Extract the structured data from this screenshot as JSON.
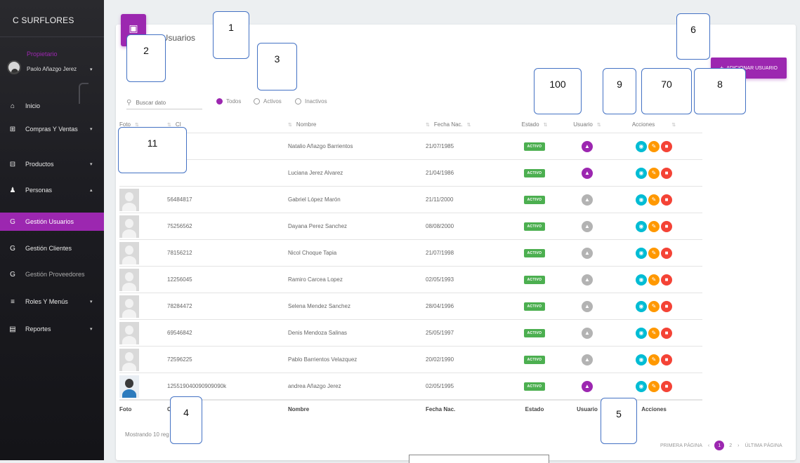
{
  "sidebar": {
    "brand": "C   SURFLORES",
    "role": "Propietario",
    "user_name": "Paolo Añazgo Jerez",
    "menu": [
      {
        "label": "Inicio",
        "icon": "home-icon",
        "glyph": "⌂",
        "caret": "",
        "active": false
      },
      {
        "label": "Compras Y Ventas",
        "icon": "cart-icon",
        "glyph": "⊞",
        "caret": "▾",
        "active": false
      },
      {
        "label": "Productos",
        "icon": "product-icon",
        "glyph": "⊟",
        "caret": "▾",
        "active": false
      },
      {
        "label": "Personas",
        "icon": "person-icon",
        "glyph": "♟",
        "caret": "▴",
        "active": false
      },
      {
        "label": "Gestión Usuarios",
        "icon": "letter-g-icon",
        "glyph": "G",
        "caret": "",
        "active": true
      },
      {
        "label": "Gestión Clientes",
        "icon": "letter-g-icon",
        "glyph": "G",
        "caret": "",
        "active": false
      },
      {
        "label": "Gestión Proveedores",
        "icon": "letter-g-icon",
        "glyph": "G",
        "caret": "",
        "active": false
      },
      {
        "label": "Roles Y Menús",
        "icon": "list-icon",
        "glyph": "≡",
        "caret": "▾",
        "active": false
      },
      {
        "label": "Reportes",
        "icon": "report-icon",
        "glyph": "▤",
        "caret": "▾",
        "active": false
      }
    ]
  },
  "card": {
    "title": "ón Usuarios",
    "add_button": "ADICIONAR USUARIO"
  },
  "filters": {
    "search_placeholder": "Buscar dato",
    "options": [
      "Todos",
      "Activos",
      "Inactivos"
    ],
    "selected": "Todos"
  },
  "table": {
    "headers": {
      "foto": "Foto",
      "ci": "CI",
      "nombre": "Nombre",
      "fecha": "Fecha Nac.",
      "estado": "Estado",
      "usuario": "Usuario",
      "acciones": "Acciones"
    },
    "rows": [
      {
        "ci": "",
        "nombre": "Natalio Añazgo Barrientos",
        "fecha": "21/07/1985",
        "estado": "ACTIVO",
        "usuario_on": true,
        "photo": "none"
      },
      {
        "ci": "",
        "nombre": "Luciana Jerez Alvarez",
        "fecha": "21/04/1986",
        "estado": "ACTIVO",
        "usuario_on": true,
        "photo": "none"
      },
      {
        "ci": "56484817",
        "nombre": "Gabriel López Marón",
        "fecha": "21/11/2000",
        "estado": "ACTIVO",
        "usuario_on": false,
        "photo": "default"
      },
      {
        "ci": "75256562",
        "nombre": "Dayana Perez Sanchez",
        "fecha": "08/08/2000",
        "estado": "ACTIVO",
        "usuario_on": false,
        "photo": "default"
      },
      {
        "ci": "78156212",
        "nombre": "Nicol Choque Tapia",
        "fecha": "21/07/1998",
        "estado": "ACTIVO",
        "usuario_on": false,
        "photo": "default"
      },
      {
        "ci": "12256045",
        "nombre": "Ramiro Carcea Lopez",
        "fecha": "02/05/1993",
        "estado": "ACTIVO",
        "usuario_on": false,
        "photo": "default"
      },
      {
        "ci": "78284472",
        "nombre": "Selena Mendez Sanchez",
        "fecha": "28/04/1996",
        "estado": "ACTIVO",
        "usuario_on": false,
        "photo": "default"
      },
      {
        "ci": "69546842",
        "nombre": "Denis Mendoza Salinas",
        "fecha": "25/05/1997",
        "estado": "ACTIVO",
        "usuario_on": false,
        "photo": "default"
      },
      {
        "ci": "72596225",
        "nombre": "Pablo Barrientos Velazquez",
        "fecha": "20/02/1990",
        "estado": "ACTIVO",
        "usuario_on": false,
        "photo": "default"
      },
      {
        "ci": "125519040090909090k",
        "nombre": "andrea Añazgo Jerez",
        "fecha": "02/05/1995",
        "estado": "ACTIVO",
        "usuario_on": true,
        "photo": "photo"
      }
    ]
  },
  "footer": {
    "showing": "Mostrando 10 reg",
    "pager": {
      "first": "PRIMERA PÁGINA",
      "prev": "‹",
      "current": "1",
      "next_page": "2",
      "next": "›",
      "last": "ÚLTIMA PÁGINA"
    }
  },
  "callouts": [
    "1",
    "2",
    "3",
    "4",
    "5",
    "6",
    "100",
    "9",
    "70",
    "8",
    "11"
  ]
}
